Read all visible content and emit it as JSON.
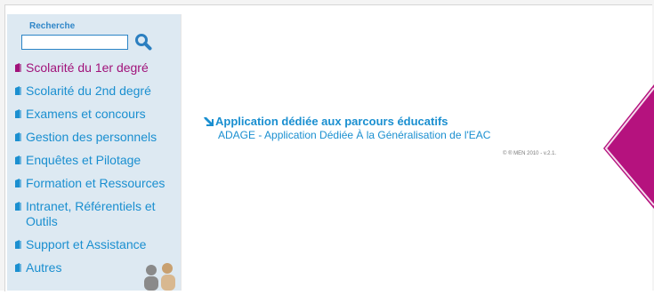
{
  "search": {
    "label": "Recherche",
    "value": "",
    "placeholder": "",
    "button_icon": "magnifier-icon"
  },
  "menu": {
    "items": [
      {
        "label": "Scolarité du 1er degré",
        "color": "#a1127a"
      },
      {
        "label": "Scolarité du 2nd degré",
        "color": "#1a8fd0"
      },
      {
        "label": "Examens et concours",
        "color": "#1a8fd0"
      },
      {
        "label": "Gestion des personnels",
        "color": "#1a8fd0"
      },
      {
        "label": "Enquêtes et Pilotage",
        "color": "#1a8fd0"
      },
      {
        "label": "Formation et Ressources",
        "color": "#1a8fd0"
      },
      {
        "label": "Intranet, Référentiels et Outils",
        "color": "#1a8fd0"
      },
      {
        "label": "Support et Assistance",
        "color": "#1a8fd0"
      },
      {
        "label": "Autres",
        "color": "#1a8fd0"
      }
    ]
  },
  "main": {
    "app_title": "Application dédiée aux parcours éducatifs",
    "app_subtitle": "ADAGE - Application Dédiée À la Généralisation de l'EAC",
    "version": "© ® MEN 2010 - v.2.1."
  },
  "colors": {
    "accent": "#1a8fd0",
    "magenta": "#a1127a",
    "sidebar_bg": "#dde9f2",
    "deco": "#b5127e"
  }
}
